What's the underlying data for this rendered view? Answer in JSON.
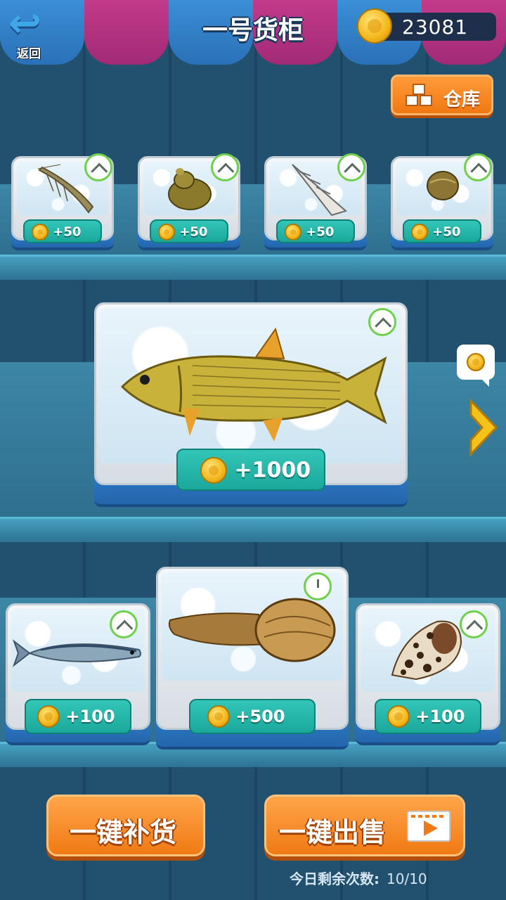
{
  "header": {
    "back_label": "返回",
    "title": "一号货柜",
    "coins": "23081",
    "warehouse_label": "仓库"
  },
  "top_row": [
    {
      "name": "shrimp",
      "reward": "+50"
    },
    {
      "name": "snail",
      "reward": "+50"
    },
    {
      "name": "auger-shell",
      "reward": "+50"
    },
    {
      "name": "clam",
      "reward": "+50"
    }
  ],
  "featured": {
    "name": "golden-dorado",
    "reward": "+1000"
  },
  "bottom_row": [
    {
      "name": "sardine",
      "reward": "+100"
    },
    {
      "name": "geoduck",
      "reward": "+500"
    },
    {
      "name": "spotted-shell",
      "reward": "+100"
    }
  ],
  "actions": {
    "restock_label": "一键补货",
    "sell_label": "一键出售",
    "remaining_label": "今日剩余次数:",
    "remaining_value": "10/10"
  },
  "colors": {
    "accent_orange": "#f07a14",
    "reward_teal": "#1aa89b",
    "timer_green": "#6fd04e"
  }
}
